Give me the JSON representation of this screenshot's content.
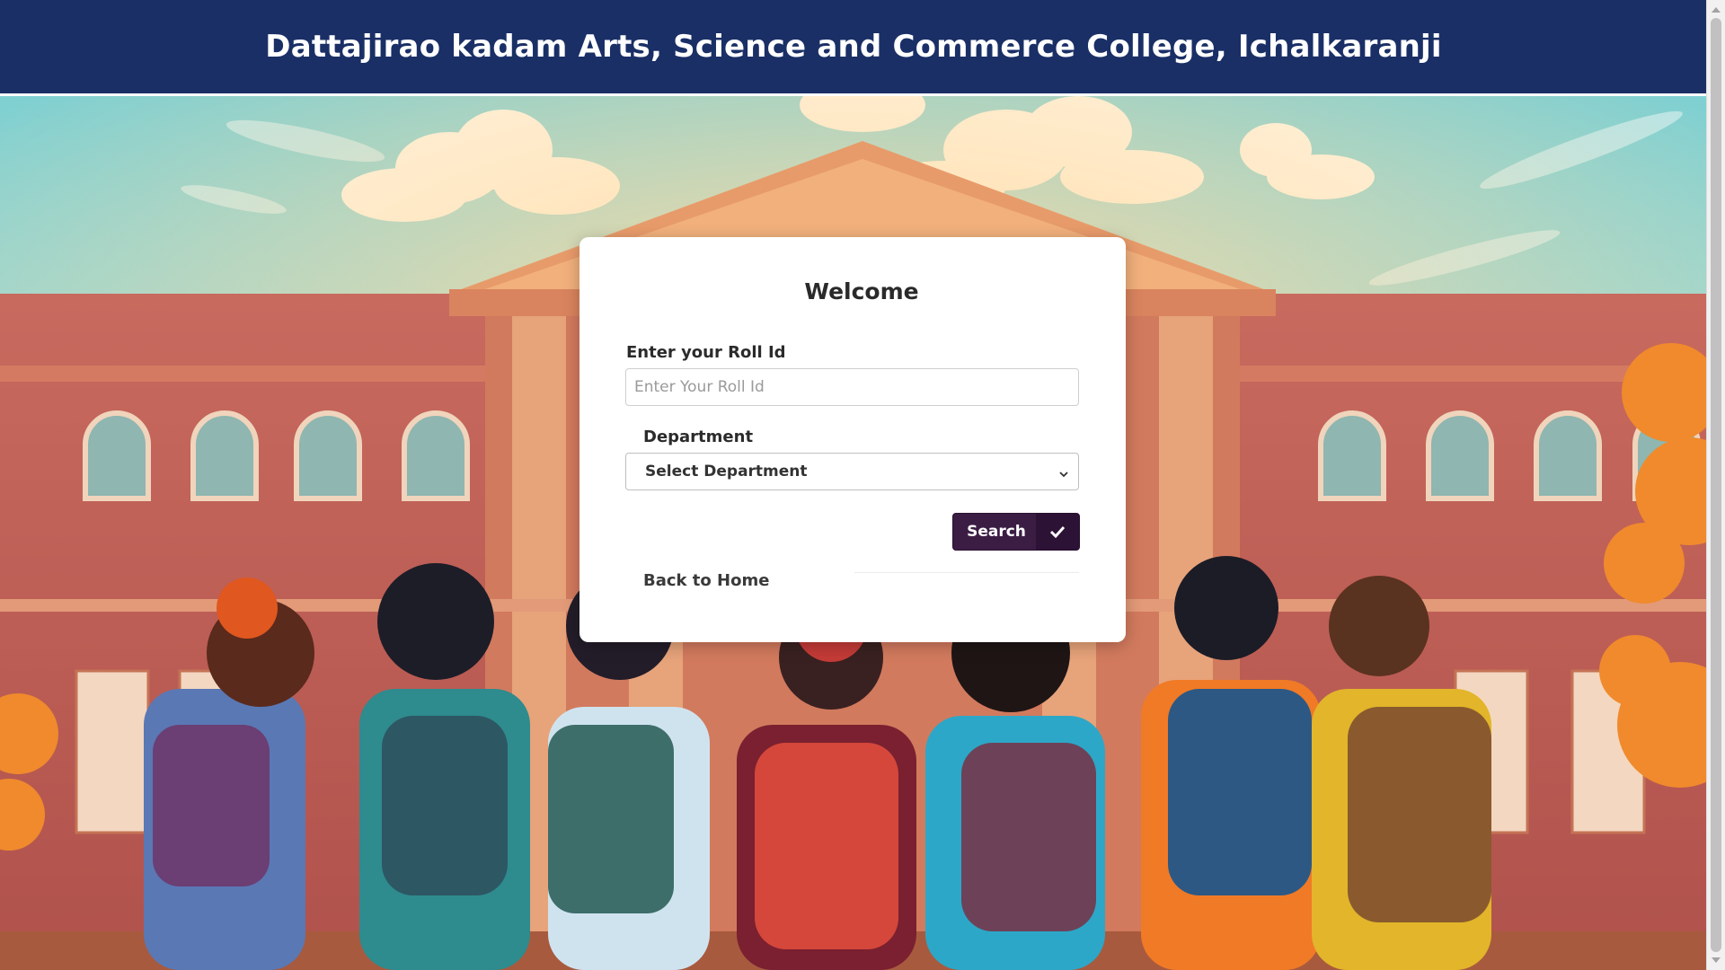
{
  "header": {
    "title": "Dattajirao kadam Arts, Science and Commerce College, Ichalkaranji",
    "background_color": "#1a2f66"
  },
  "background": {
    "description_icon": "college-building-students-illustration"
  },
  "login_card": {
    "title": "Welcome",
    "roll_label": "Enter your Roll Id",
    "roll_placeholder": "Enter Your Roll Id",
    "roll_value": "",
    "department_label": "Department",
    "department_selected": "Select Department",
    "search_label": "Search",
    "search_icon": "check-icon",
    "back_link": "Back to Home",
    "button_color": "#3b1d44"
  }
}
